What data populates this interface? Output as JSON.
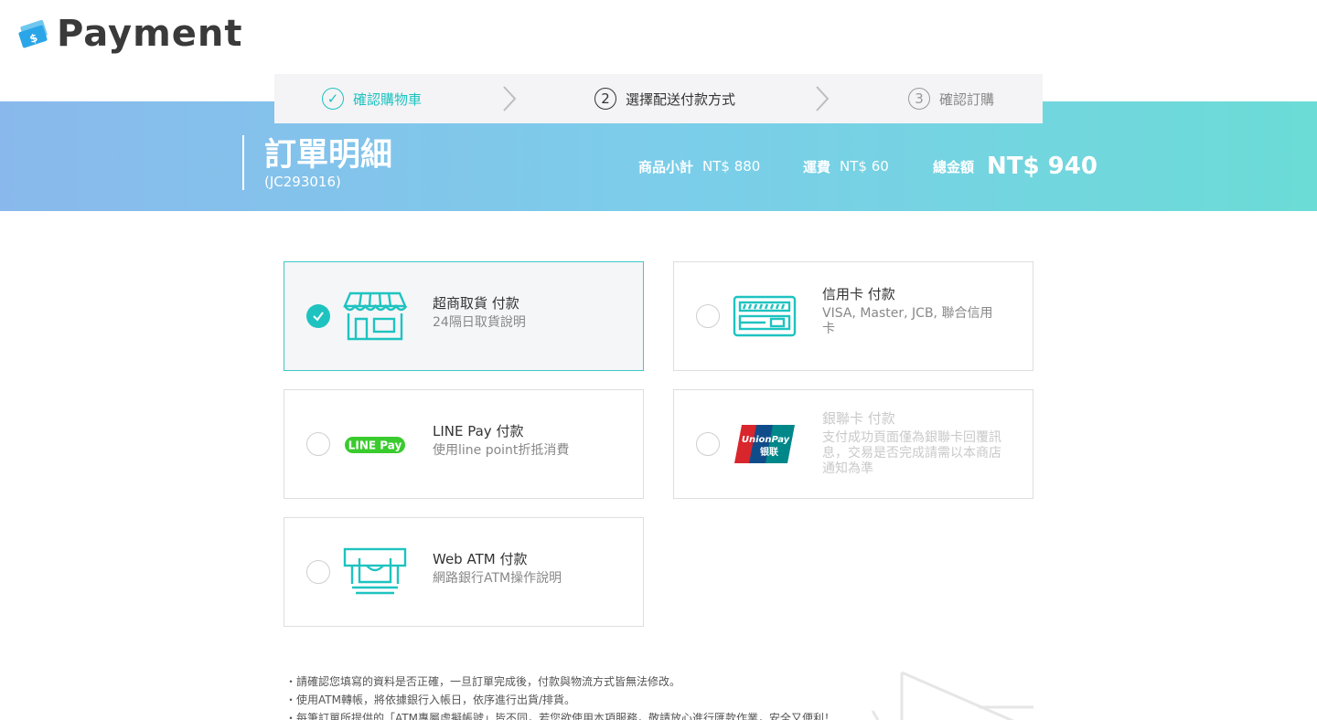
{
  "logo": {
    "text": "Payment",
    "icon": "wallet-card-icon",
    "icon_glyph": "$"
  },
  "steps": [
    {
      "label": "確認購物車",
      "marker": "✓",
      "state": "done"
    },
    {
      "label": "選擇配送付款方式",
      "marker": "2",
      "state": "current"
    },
    {
      "label": "確認訂購",
      "marker": "3",
      "state": "pending"
    }
  ],
  "order": {
    "title": "訂單明細",
    "id": "(JC293016)",
    "subtotal_label": "商品小計",
    "subtotal_value": "NT$ 880",
    "shipping_label": "運費",
    "shipping_value": "NT$ 60",
    "total_label": "總金額",
    "total_value": "NT$ 940"
  },
  "payments": [
    {
      "title": "超商取貨 付款",
      "desc": "24隔日取貨說明",
      "icon": "store-icon",
      "selected": true,
      "disabled": false
    },
    {
      "title": "信用卡 付款",
      "desc": "VISA, Master, JCB, 聯合信用卡",
      "icon": "credit-card-icon",
      "selected": false,
      "disabled": false
    },
    {
      "title": "LINE Pay 付款",
      "desc": "使用line point折抵消費",
      "icon": "line-pay-logo",
      "logo_text": "LINE Pay",
      "selected": false,
      "disabled": false
    },
    {
      "title": "銀聯卡 付款",
      "desc": "支付成功頁面僅為銀聯卡回覆訊息，交易是否完成請需以本商店通知為準",
      "icon": "unionpay-logo",
      "logo_text": "UnionPay",
      "logo_cn": "银联",
      "selected": false,
      "disabled": true
    },
    {
      "title": "Web ATM 付款",
      "desc": "網路銀行ATM操作說明",
      "icon": "atm-icon",
      "selected": false,
      "disabled": false
    }
  ],
  "notes": [
    "・請確認您填寫的資料是否正確，一旦訂單完成後，付款與物流方式皆無法修改。",
    "・使用ATM轉帳，將依據銀行入帳日，依序進行出貨/排貨。",
    "・每筆訂單所提供的「ATM專屬虛擬帳號」皆不同，若您欲使用本項服務，敬請放心進行匯款作業，安全又便利！"
  ],
  "colors": {
    "accent": "#1ec3c0",
    "banner_start": "#89b9ec",
    "banner_end": "#6bdcd6",
    "logo_blue": "#2aa6e8"
  }
}
